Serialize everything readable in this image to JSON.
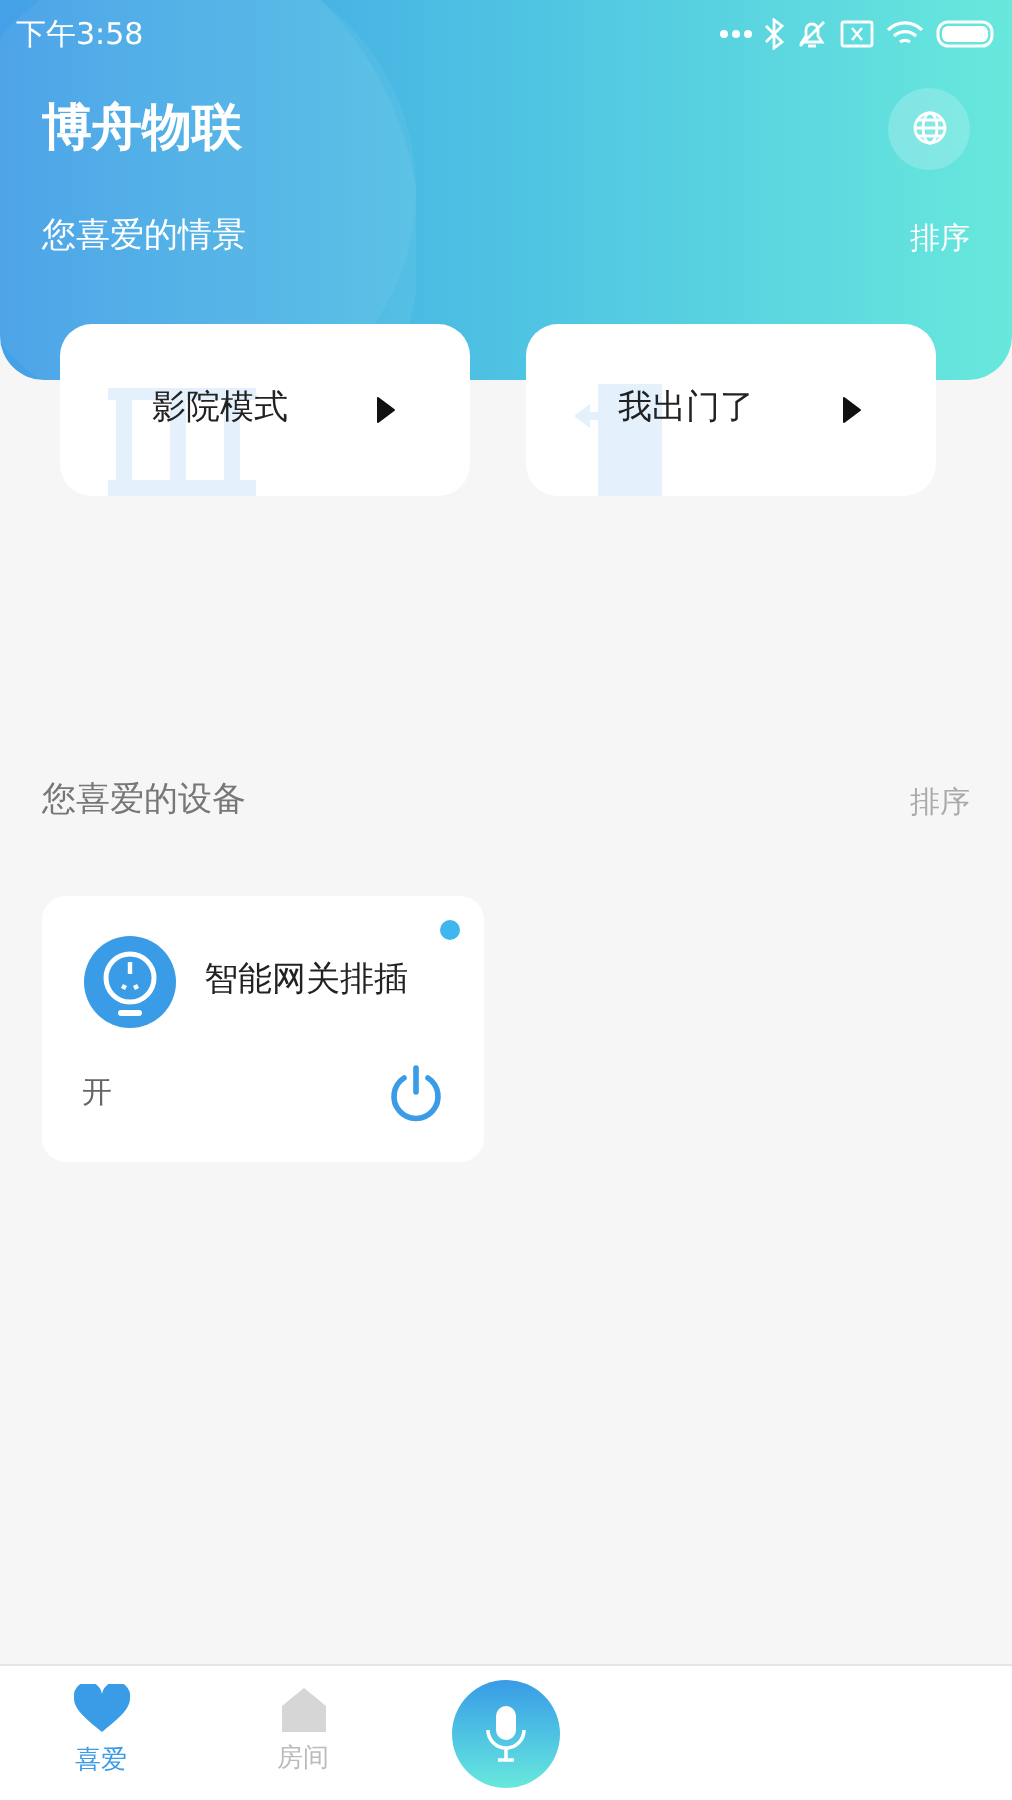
{
  "status_bar": {
    "time": "下午3:58"
  },
  "header": {
    "title": "博舟物联"
  },
  "scenes_section": {
    "title": "您喜爱的情景",
    "sort": "排序"
  },
  "scenes": [
    {
      "kind": "cinema",
      "label": "影院模式"
    },
    {
      "kind": "leave",
      "label": "我出门了"
    }
  ],
  "devices_section": {
    "title": "您喜爱的设备",
    "sort": "排序"
  },
  "devices": [
    {
      "name": "智能网关排插",
      "status": "开",
      "on": true,
      "online": true
    }
  ],
  "bottom_nav": [
    {
      "kind": "favorite",
      "label": "喜爱",
      "selected": true
    },
    {
      "kind": "room",
      "label": "房间",
      "selected": false
    },
    {
      "kind": "voice"
    }
  ]
}
